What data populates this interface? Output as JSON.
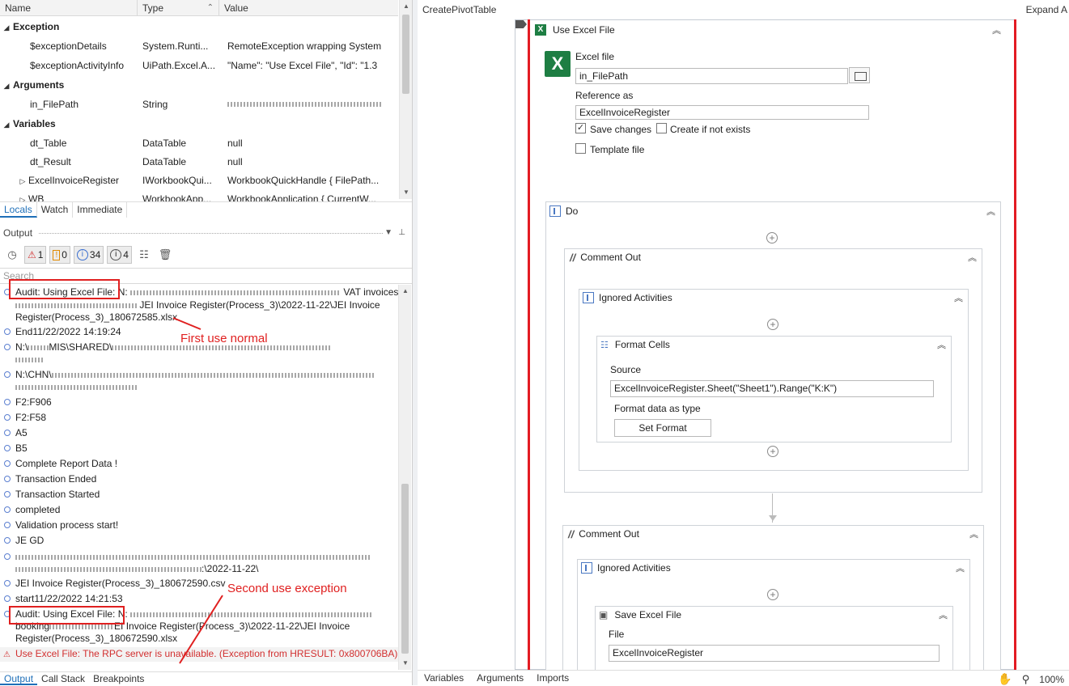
{
  "locals": {
    "columns": {
      "name": "Name",
      "type": "Type",
      "value": "Value"
    },
    "groups": {
      "exception": "Exception",
      "arguments": "Arguments",
      "variables": "Variables"
    },
    "rows": {
      "exceptionDetails": {
        "name": "$exceptionDetails",
        "type": "System.Runti...",
        "value": "RemoteException wrapping System"
      },
      "exceptionActivityInfo": {
        "name": "$exceptionActivityInfo",
        "type": "UiPath.Excel.A...",
        "value": " \"Name\": \"Use Excel File\",  \"Id\": \"1.3"
      },
      "in_FilePath": {
        "name": "in_FilePath",
        "type": "String",
        "value": ""
      },
      "dt_Table": {
        "name": "dt_Table",
        "type": "DataTable",
        "value": "null"
      },
      "dt_Result": {
        "name": "dt_Result",
        "type": "DataTable",
        "value": "null"
      },
      "ExcelInvoiceRegister": {
        "name": "ExcelInvoiceRegister",
        "type": "IWorkbookQui...",
        "value": "WorkbookQuickHandle { FilePath..."
      },
      "WB": {
        "name": "WB",
        "type": "WorkbookApp...",
        "value": "WorkbookApplication { CurrentW..."
      }
    },
    "tabs": [
      "Locals",
      "Watch",
      "Immediate"
    ]
  },
  "output": {
    "title": "Output",
    "counts": {
      "errors": "1",
      "warnings": "0",
      "info": "34",
      "trace": "4"
    },
    "search_placeholder": "Search",
    "lines": {
      "l1a": "Audit: Using Excel File: N:",
      "l1b": "VAT invoices",
      "l1c": "JEI Invoice Register(Process_3)\\2022-11-22\\JEI Invoice",
      "l1d": "Register(Process_3)_180672585.xlsx",
      "l2": "End11/22/2022 14:19:24",
      "l3a": "N:\\",
      "l3b": "MIS\\SHARED\\",
      "l4a": "N:\\CHN\\",
      "l5": "F2:F906",
      "l6": "F2:F58",
      "l7": "A5",
      "l8": "B5",
      "l9": "Complete Report Data !",
      "l10": "Transaction Ended",
      "l11": "Transaction Started",
      "l12": "completed",
      "l13": "Validation process start!",
      "l14": "JE GD",
      "l15b": ":\\2022-11-22\\",
      "l16": "JEI Invoice Register(Process_3)_180672590.csv",
      "l17": "start11/22/2022 14:21:53",
      "l18a": "Audit: Using Excel File: N:",
      "l18c": "EI Invoice Register(Process_3)\\2022-11-22\\JEI Invoice",
      "l18b": "booking",
      "l18d": "Register(Process_3)_180672590.xlsx",
      "err": "Use Excel File: The RPC server is unavailable. (Exception from HRESULT: 0x800706BA)"
    },
    "annotations": {
      "first": "First use normal",
      "second": "Second use exception"
    },
    "tabs": [
      "Output",
      "Call Stack",
      "Breakpoints"
    ]
  },
  "designer": {
    "breadcrumb": "CreatePivotTable",
    "expand_all": "Expand A",
    "use_excel": {
      "title": "Use Excel File",
      "excel_file_label": "Excel file",
      "excel_file_value": "in_FilePath",
      "reference_label": "Reference as",
      "reference_value": "ExcelInvoiceRegister",
      "save_changes": "Save changes",
      "create_if_not_exists": "Create if not exists",
      "template_file": "Template file"
    },
    "do": "Do",
    "comment_out_1": "Comment Out",
    "ignored_1": "Ignored Activities",
    "format_cells": {
      "title": "Format Cells",
      "source_label": "Source",
      "source_value": "ExcelInvoiceRegister.Sheet(\"Sheet1\").Range(\"K:K\")",
      "format_label": "Format data as type",
      "set_format": "Set Format"
    },
    "comment_out_2": "Comment Out",
    "ignored_2": "Ignored Activities",
    "save_excel": {
      "title": "Save Excel File",
      "file_label": "File",
      "file_value": "ExcelInvoiceRegister"
    },
    "status_tabs": [
      "Variables",
      "Arguments",
      "Imports"
    ],
    "zoom": "100%"
  }
}
